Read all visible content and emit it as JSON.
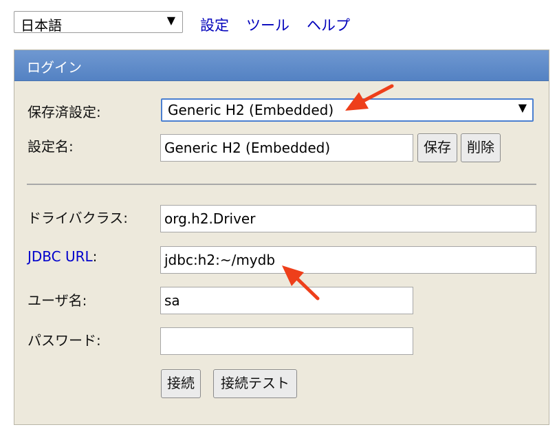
{
  "top": {
    "language": "日本語",
    "links": [
      "設定",
      "ツール",
      "ヘルプ"
    ]
  },
  "panel": {
    "title": "ログイン",
    "saved_settings_label": "保存済設定:",
    "saved_settings_value": "Generic H2 (Embedded)",
    "setting_name_label": "設定名:",
    "setting_name_value": "Generic H2 (Embedded)",
    "save_button": "保存",
    "delete_button": "削除",
    "driver_class_label": "ドライバクラス:",
    "driver_class_value": "org.h2.Driver",
    "jdbc_url_label": "JDBC URL",
    "jdbc_url_suffix": ":",
    "jdbc_url_value": "jdbc:h2:~/mydb",
    "username_label": "ユーザ名:",
    "username_value": "sa",
    "password_label": "パスワード:",
    "password_value": "",
    "connect_button": "接続",
    "test_connection_button": "接続テスト"
  },
  "colors": {
    "header_blue": "#5f8bc9",
    "panel_bg": "#ede9dc",
    "link": "#0000bb",
    "annotation_arrow": "#ee3f1a"
  },
  "icons": {
    "dropdown": "dropdown-triangle-icon",
    "annotation": "red-arrow-icon"
  }
}
